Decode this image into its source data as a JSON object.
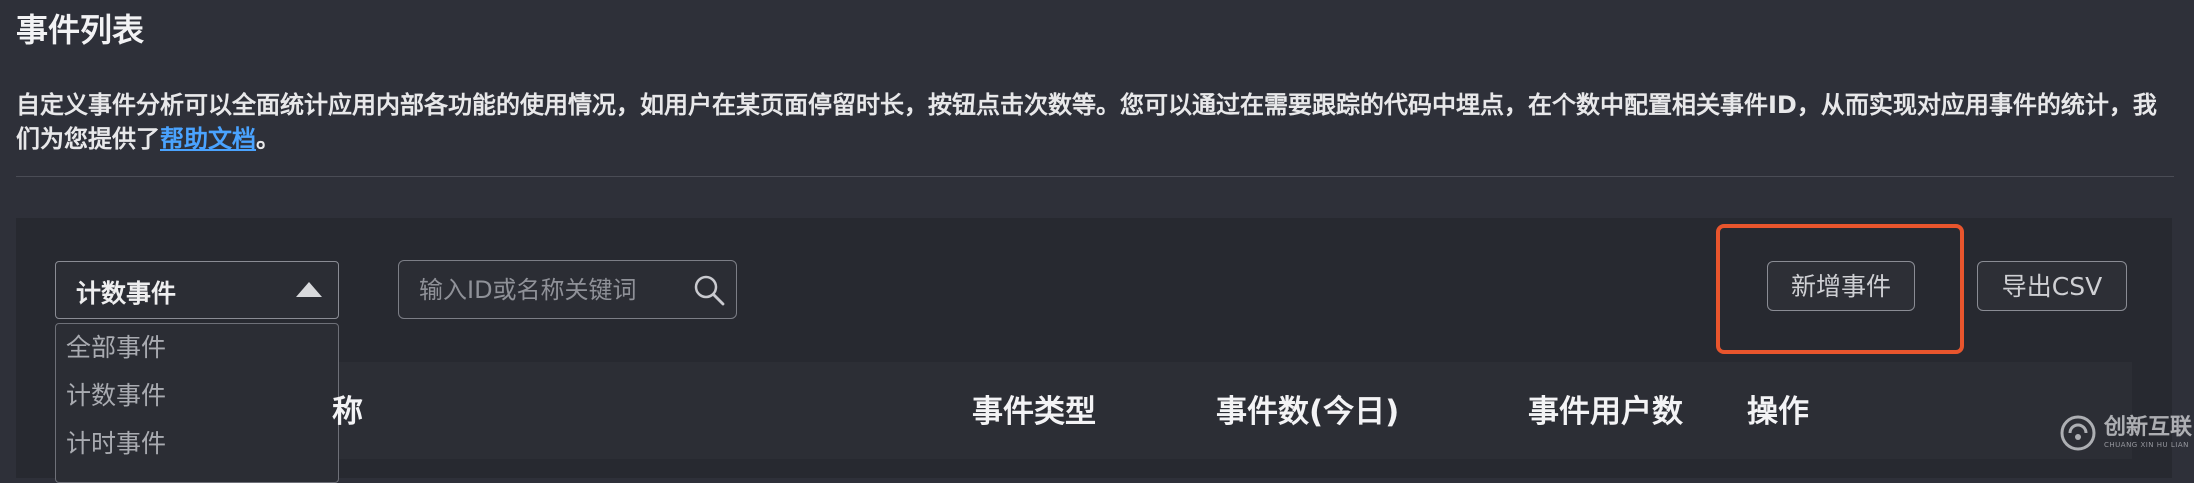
{
  "page": {
    "title": "事件列表"
  },
  "description": {
    "text": "自定义事件分析可以全面统计应用内部各功能的使用情况，如用户在某页面停留时长，按钮点击次数等。您可以通过在需要跟踪的代码中埋点，在个数中配置相关事件ID，从而实现对应用事件的统计，我们为您提供了",
    "link": "帮助文档",
    "suffix": "。"
  },
  "filter": {
    "selected": "计数事件",
    "options": [
      "全部事件",
      "计数事件",
      "计时事件"
    ]
  },
  "search": {
    "placeholder": "输入ID或名称关键词"
  },
  "actions": {
    "add_label": "新增事件",
    "export_label": "导出CSV"
  },
  "table": {
    "headers": {
      "name_partial": "称",
      "type": "事件类型",
      "count_today": "事件数(今日)",
      "users": "事件用户数",
      "ops": "操作"
    }
  },
  "watermark": {
    "text": "创新互联",
    "subtext": "CHUANG XIN HU LIAN"
  },
  "colors": {
    "background": "#2e3039",
    "panel": "#272930",
    "link": "#4aa3ff",
    "highlight": "#e8552d"
  }
}
